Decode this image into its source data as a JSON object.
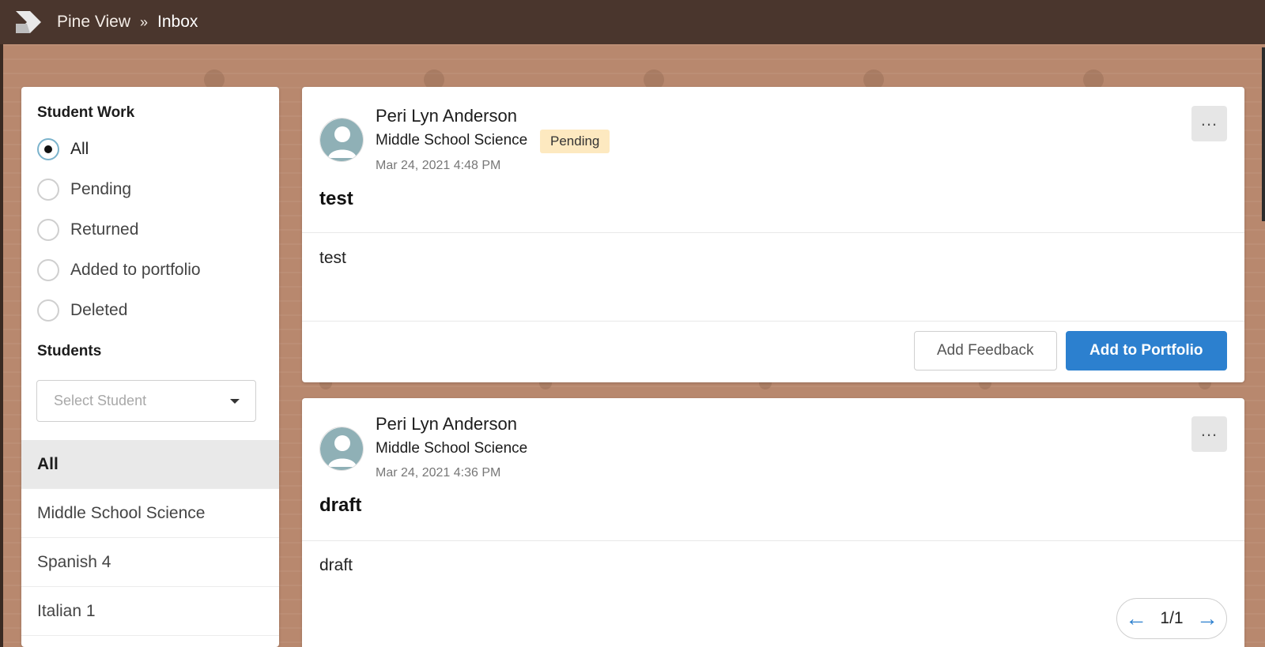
{
  "header": {
    "site": "Pine View",
    "separator": "»",
    "current": "Inbox"
  },
  "sidebar": {
    "student_work_title": "Student Work",
    "filters": [
      {
        "label": "All",
        "checked": true
      },
      {
        "label": "Pending",
        "checked": false
      },
      {
        "label": "Returned",
        "checked": false
      },
      {
        "label": "Added to portfolio",
        "checked": false
      },
      {
        "label": "Deleted",
        "checked": false
      }
    ],
    "students_title": "Students",
    "student_select_placeholder": "Select Student",
    "classes": [
      {
        "label": "All",
        "selected": true
      },
      {
        "label": "Middle School Science",
        "selected": false
      },
      {
        "label": "Spanish 4",
        "selected": false
      },
      {
        "label": "Italian 1",
        "selected": false
      }
    ]
  },
  "posts": [
    {
      "student": "Peri Lyn Anderson",
      "class": "Middle School Science",
      "status": "Pending",
      "date": "Mar 24, 2021 4:48 PM",
      "title": "test",
      "body": "test",
      "add_feedback_label": "Add Feedback",
      "add_portfolio_label": "Add to Portfolio"
    },
    {
      "student": "Peri Lyn Anderson",
      "class": "Middle School Science",
      "date": "Mar 24, 2021 4:36 PM",
      "title": "draft",
      "body": "draft"
    }
  ],
  "pagination": {
    "page": "1/1",
    "prev_icon": "arrow-left-icon",
    "next_icon": "arrow-right-icon"
  },
  "colors": {
    "topbar": "#4a362d",
    "background": "#b8886e",
    "primary": "#2c80cf",
    "pending_badge": "#fde9c0"
  }
}
